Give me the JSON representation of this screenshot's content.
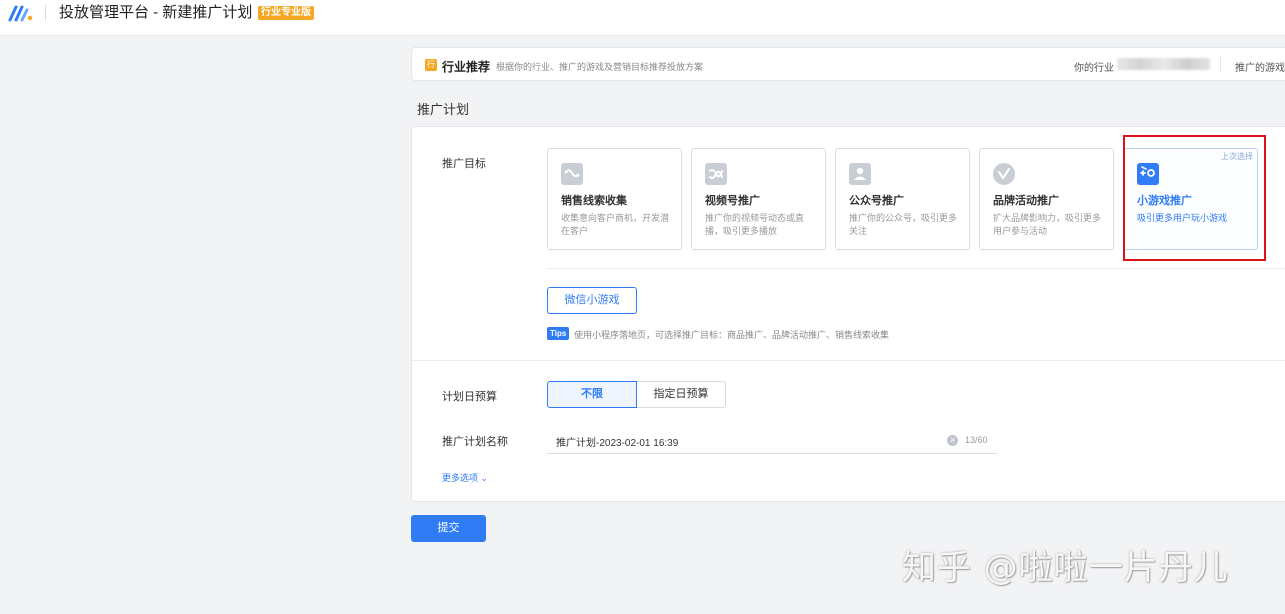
{
  "header": {
    "title": "投放管理平台 - 新建推广计划",
    "edition_badge": "行业专业版"
  },
  "recommend": {
    "icon_char": "行",
    "title": "行业推荐",
    "description": "根据你的行业、推广的游戏及营销目标推荐投放方案",
    "industry_label": "你的行业",
    "game_label": "推广的游戏"
  },
  "section_title": "推广计划",
  "goal": {
    "label": "推广目标",
    "cards": [
      {
        "title": "销售线索收集",
        "desc": "收集意向客户商机，开发潜在客户",
        "icon": "leads-icon"
      },
      {
        "title": "视频号推广",
        "desc": "推广你的视频号动态或直播，吸引更多播放",
        "icon": "channels-icon"
      },
      {
        "title": "公众号推广",
        "desc": "推广你的公众号，吸引更多关注",
        "icon": "official-account-icon"
      },
      {
        "title": "品牌活动推广",
        "desc": "扩大品牌影响力，吸引更多用户参与活动",
        "icon": "brand-icon"
      },
      {
        "title": "小游戏推广",
        "desc": "吸引更多用户玩小游戏",
        "icon": "minigame-icon",
        "tag": "上次选择",
        "selected": true
      }
    ],
    "sub_option": "微信小游戏",
    "tips_badge": "Tips",
    "tips_text": "使用小程序落地页，可选择推广目标：商品推广、品牌活动推广、销售线索收集"
  },
  "budget": {
    "label": "计划日预算",
    "options": [
      "不限",
      "指定日预算"
    ],
    "selected": "不限"
  },
  "plan_name": {
    "label": "推广计划名称",
    "value": "推广计划-2023-02-01 16:39",
    "count": "13/60"
  },
  "more_options": "更多选项",
  "submit_label": "提交",
  "watermark": "知乎 @啦啦一片丹儿",
  "colors": {
    "accent": "#2f7cf6",
    "badge": "#f5a623",
    "highlight": "#d9141b"
  }
}
